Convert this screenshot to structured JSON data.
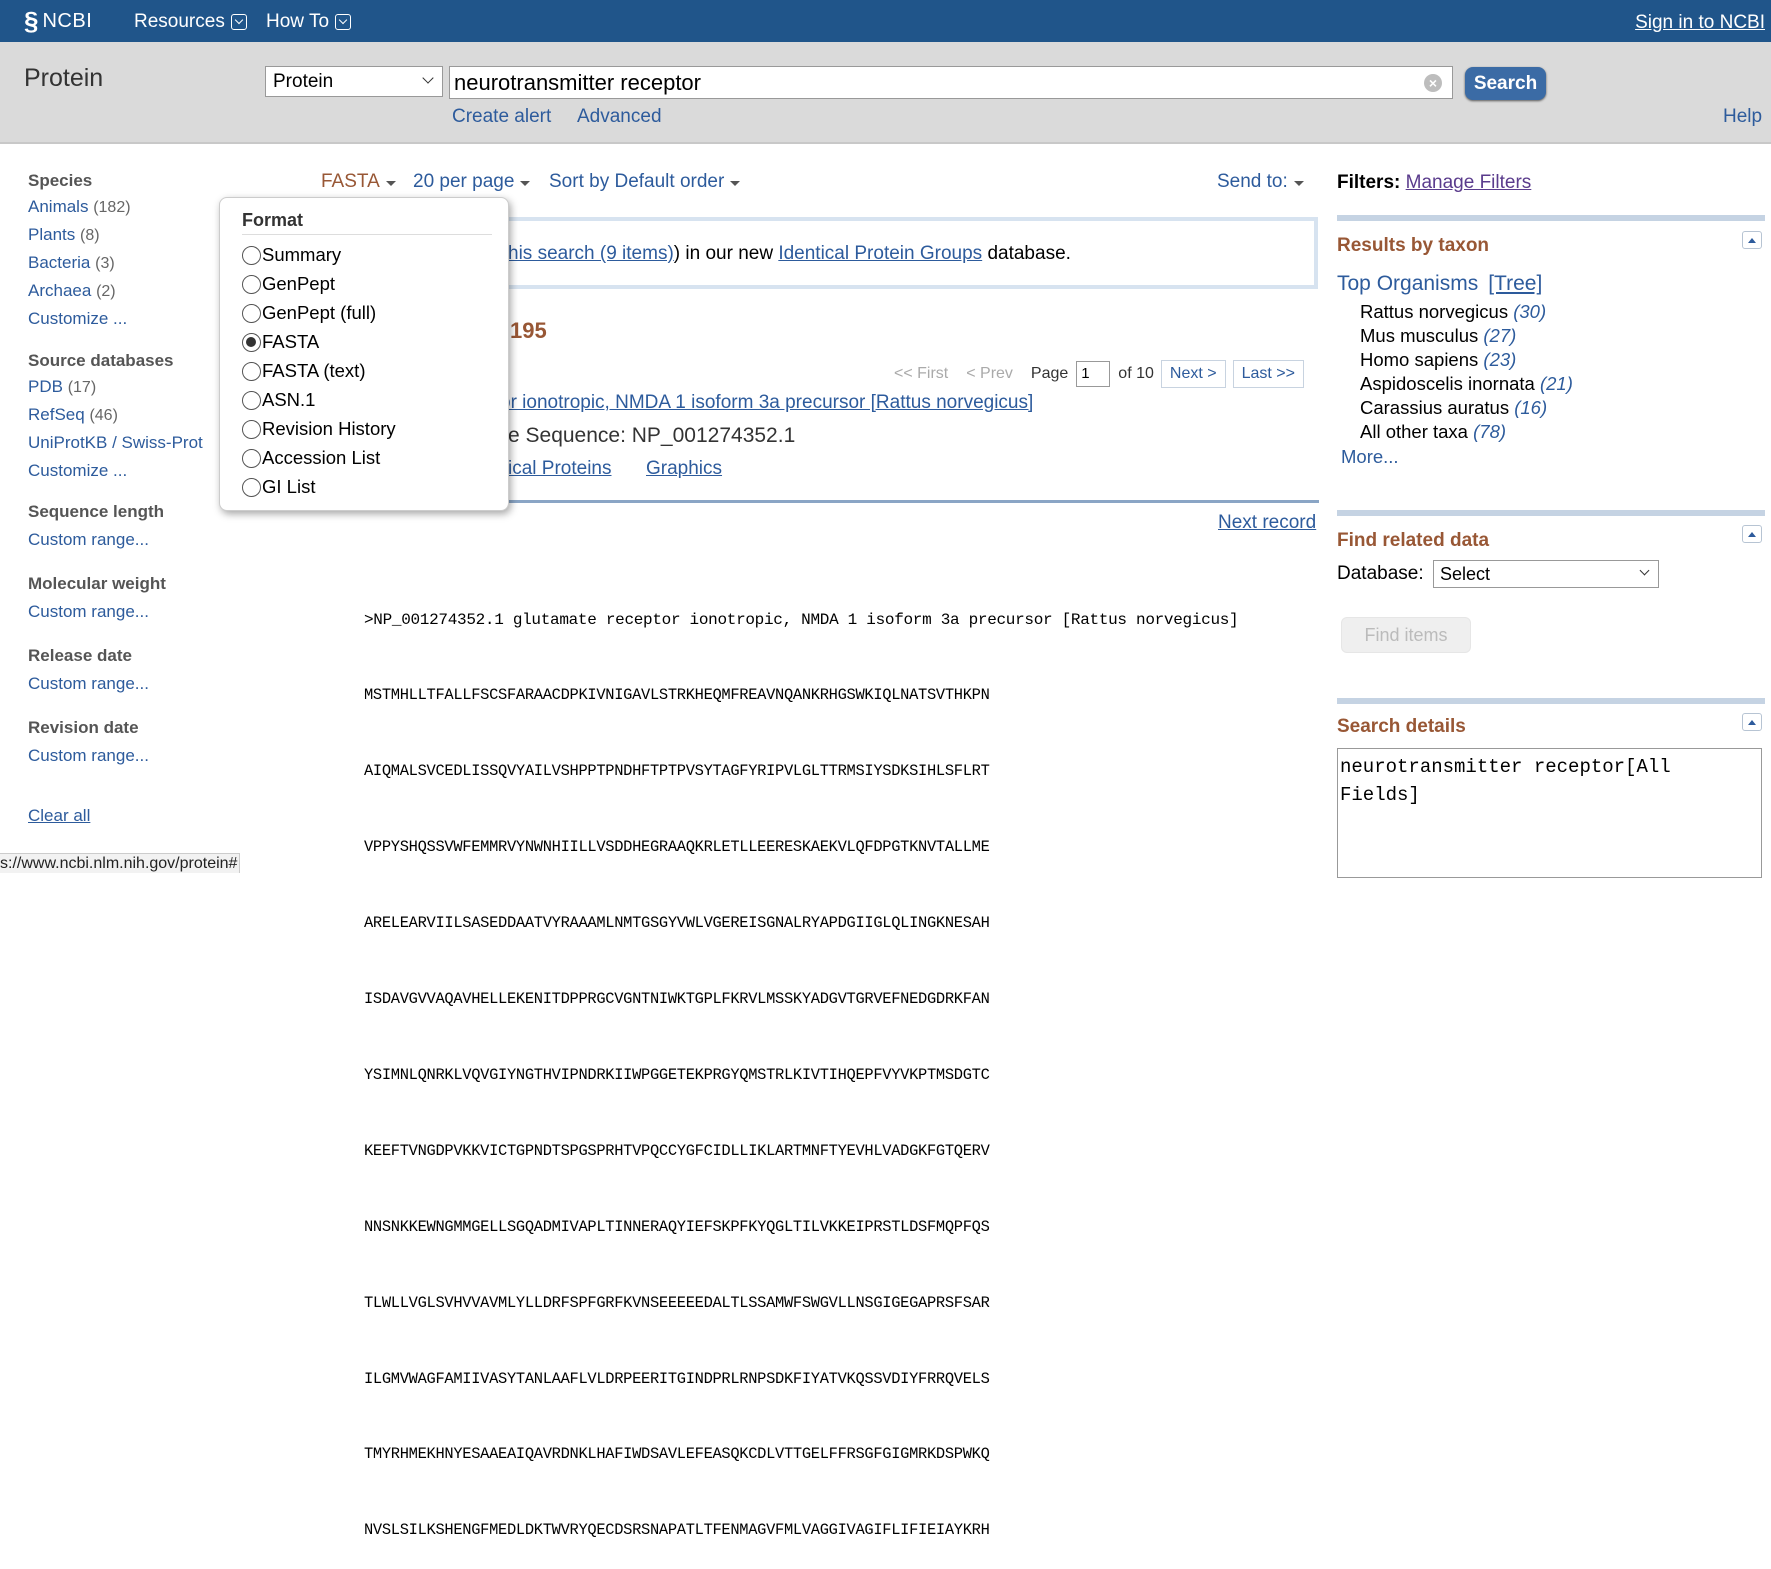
{
  "topbar": {
    "logo": "NCBI",
    "menu_resources": "Resources",
    "menu_howto": "How To",
    "signin": "Sign in to NCBI"
  },
  "search": {
    "db_title": "Protein",
    "db_select": "Protein",
    "term": "neurotransmitter receptor",
    "button": "Search",
    "create_alert": "Create alert",
    "advanced": "Advanced",
    "help": "Help"
  },
  "sidebar": {
    "species": {
      "heading": "Species",
      "items": [
        {
          "label": "Animals",
          "count": "(182)"
        },
        {
          "label": "Plants",
          "count": "(8)"
        },
        {
          "label": "Bacteria",
          "count": "(3)"
        },
        {
          "label": "Archaea",
          "count": "(2)"
        },
        {
          "label": "Customize ...",
          "count": ""
        }
      ]
    },
    "source": {
      "heading": "Source databases",
      "items": [
        {
          "label": "PDB",
          "count": "(17)"
        },
        {
          "label": "RefSeq",
          "count": "(46)"
        },
        {
          "label": "UniProtKB / Swiss-Prot",
          "count": ""
        },
        {
          "label": "Customize ...",
          "count": ""
        }
      ]
    },
    "seqlen": {
      "heading": "Sequence length",
      "item": "Custom range..."
    },
    "molwt": {
      "heading": "Molecular weight",
      "item": "Custom range..."
    },
    "release": {
      "heading": "Release date",
      "item": "Custom range..."
    },
    "revision": {
      "heading": "Revision date",
      "item": "Custom range..."
    },
    "clear_all": "Clear all"
  },
  "controls": {
    "format": "FASTA",
    "per_page": "20 per page",
    "sort": "Sort by Default order",
    "send_to": "Send to:"
  },
  "message": {
    "link1": "his search (9 items)",
    "mid": ") in our new ",
    "link2": "Identical Protein Groups",
    "end": " database."
  },
  "results": {
    "count_fragment": "195",
    "pager": {
      "first": "<< First",
      "prev": "< Prev",
      "page_label": "Page",
      "page_value": "1",
      "of": "of 10",
      "next": "Next >",
      "last": "Last >>"
    },
    "record_title": "or ionotropic, NMDA 1 isoform 3a precursor [Rattus norvegicus]",
    "refseq": "e Sequence: NP_001274352.1",
    "link_identical": "ical Proteins",
    "link_graphics": "Graphics",
    "next_record": "Next record"
  },
  "fasta": {
    "header": ">NP_001274352.1 glutamate receptor ionotropic, NMDA 1 isoform 3a precursor [Rattus norvegicus]",
    "lines": [
      "MSTMHLLTFALLFSCSFARAACDPKIVNIGAVLSTRKHEQMFREAVNQANKRHGSWKIQLNATSVTHKPN",
      "AIQMALSVCEDLISSQVYAILVSHPPTPNDHFTPTPVSYTAGFYRIPVLGLTTRMSIYSDKSIHLSFLRT",
      "VPPYSHQSSVWFEMMRVYNWNHIILLVSDDHEGRAAQKRLETLLEERESKAEKVLQFDPGTKNVTALLME",
      "ARELEARVIILSASEDDAATVYRAAAMLNMTGSGYVWLVGEREISGNALRYAPDGIIGLQLINGKNESAH",
      "ISDAVGVVAQAVHELLEKENITDPPRGCVGNTNIWKTGPLFKRVLMSSKYADGVTGRVEFNEDGDRKFAN",
      "YSIMNLQNRKLVQVGIYNGTHVIPNDRKIIWPGGETEKPRGYQMSTRLKIVTIHQEPFVYVKPTMSDGTC",
      "KEEFTVNGDPVKKVICTGPNDTSPGSPRHTVPQCCYGFCIDLLIKLARTMNFTYEVHLVADGKFGTQERV",
      "NNSNKKEWNGMMGELLSGQADMIVAPLTINNERAQYIEFSKPFKYQGLTILVKKEIPRSTLDSFMQPFQS",
      "TLWLLVGLSVHVVAVMLYLLDRFSPFGRFKVNSEEEEEDALTLSSAMWFSWGVLLNSGIGEGAPRSFSAR",
      "ILGMVWAGFAMIIVASYTANLAAFLVLDRPEERITGINDPRLRNPSDKFIYATVKQSSVDIYFRRQVELS",
      "TMYRHMEKHNYESAAEAIQAVRDNKLHAFIWDSAVLEFEASQKCDLVTTGELFFRSGFGIGMRKDSPWKQ",
      "NVSLSILKSHENGFMEDLDKTWVRYQECDSRSNAPATLTFENMAGVFMLVAGGIVAGIFLIFIEIAYKRH"
    ]
  },
  "right": {
    "filters_label": "Filters:",
    "manage_filters": "Manage Filters",
    "taxon_heading": "Results by taxon",
    "top_organisms": "Top Organisms",
    "tree": "[Tree]",
    "organisms": [
      {
        "name": "Rattus norvegicus",
        "count": "(30)"
      },
      {
        "name": "Mus musculus",
        "count": "(27)"
      },
      {
        "name": "Homo sapiens",
        "count": "(23)"
      },
      {
        "name": "Aspidoscelis inornata",
        "count": "(21)"
      },
      {
        "name": "Carassius auratus",
        "count": "(16)"
      },
      {
        "name": "All other taxa",
        "count": "(78)"
      }
    ],
    "more": "More...",
    "related_heading": "Find related data",
    "database_label": "Database:",
    "database_select": "Select",
    "find_items": "Find items",
    "details_heading": "Search details",
    "details_text": "neurotransmitter receptor[All Fields]"
  },
  "format_popup": {
    "title": "Format",
    "options": [
      "Summary",
      "GenPept",
      "GenPept (full)",
      "FASTA",
      "FASTA (text)",
      "ASN.1",
      "Revision History",
      "Accession List",
      "GI List"
    ],
    "selected": "FASTA"
  },
  "status_bar": "s://www.ncbi.nlm.nih.gov/protein#",
  "colors": {
    "topbar": "#20558a",
    "link": "#2d5b9c",
    "heading_accent": "#985735",
    "search_button": "#3b6ba5"
  }
}
